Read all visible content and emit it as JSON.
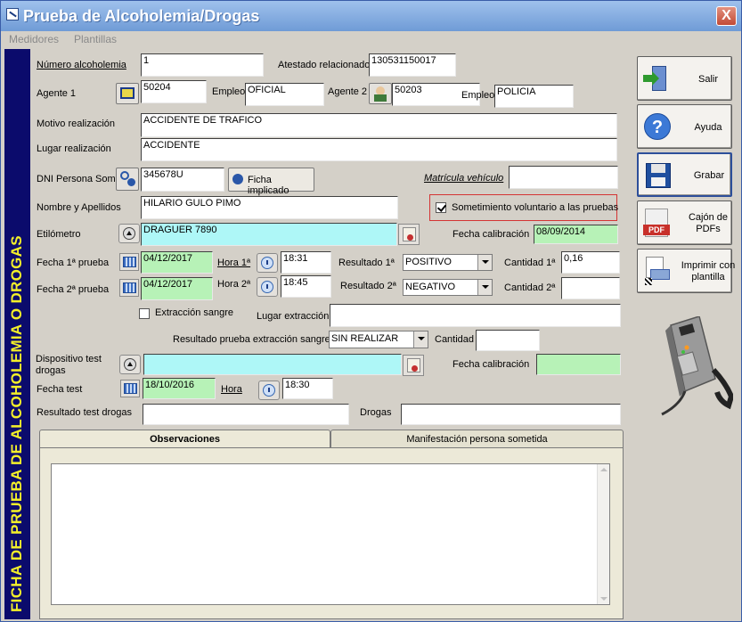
{
  "window": {
    "title": "Prueba de Alcoholemia/Drogas",
    "close_glyph": "X"
  },
  "menu": {
    "items": [
      "Medidores",
      "Plantillas"
    ]
  },
  "sidebar": {
    "text": "FICHA DE PRUEBA DE ALCOHOLEMIA O DROGAS"
  },
  "form": {
    "numero_label": "Número alcoholemia",
    "numero_value": "1",
    "atestado_label": "Atestado relacionado",
    "atestado_value": "130531150017",
    "agente1_label": "Agente 1",
    "agente1_value": "50204",
    "empleo1_label": "Empleo",
    "empleo1_value": "OFICIAL",
    "agente2_label": "Agente 2",
    "agente2_value": "50203",
    "empleo2_label": "Empleo",
    "empleo2_value": "POLICIA",
    "motivo_label": "Motivo realización",
    "motivo_value": "ACCIDENTE DE TRAFICO",
    "lugar_label": "Lugar realización",
    "lugar_value": "ACCIDENTE",
    "dni_label": "DNI Persona Som.",
    "dni_value": "345678U",
    "ficha_button": "Ficha implicado",
    "matricula_label": "Matrícula vehículo",
    "matricula_value": "",
    "nombre_label": "Nombre y Apellidos",
    "nombre_value": "HILARIO GULO PIMO",
    "sometimiento_label": "Sometimiento voluntario a las pruebas",
    "etilometro_label": "Etilómetro",
    "etilometro_value": "DRAGUER 7890",
    "fecha_cal_label": "Fecha calibración",
    "fecha_cal_value": "08/09/2014",
    "fecha1_label": "Fecha 1ª prueba",
    "fecha1_value": "04/12/2017",
    "hora1_label": "Hora 1ª",
    "hora1_value": "18:31",
    "resultado1_label": "Resultado 1ª",
    "resultado1_value": "POSITIVO",
    "cantidad1_label": "Cantidad 1ª",
    "cantidad1_value": "0,16",
    "fecha2_label": "Fecha 2ª prueba",
    "fecha2_value": "04/12/2017",
    "hora2_label": "Hora 2ª",
    "hora2_value": "18:45",
    "resultado2_label": "Resultado 2ª",
    "resultado2_value": "NEGATIVO",
    "cantidad2_label": "Cantidad 2ª",
    "cantidad2_value": "",
    "extraccion_label": "Extracción sangre",
    "lugar_extraccion_label": "Lugar extracción",
    "lugar_extraccion_value": "",
    "resultado_extraccion_label": "Resultado prueba extracción sangre",
    "resultado_extraccion_value": "SIN REALIZAR",
    "cantidad_label": "Cantidad",
    "cantidad_value": "",
    "dispositivo_label": "Dispositivo test drogas",
    "dispositivo_value": "",
    "fecha_cal2_label": "Fecha calibración",
    "fecha_cal2_value": "",
    "fecha_test_label": "Fecha test",
    "fecha_test_value": "18/10/2016",
    "hora_label": "Hora",
    "hora_value": "18:30",
    "resultado_test_label": "Resultado test drogas",
    "resultado_test_value": "",
    "drogas_label": "Drogas",
    "drogas_value": ""
  },
  "tabs": {
    "observaciones": "Observaciones",
    "manifestacion": "Manifestación persona sometida"
  },
  "actions": {
    "salir": "Salir",
    "ayuda": "Ayuda",
    "grabar": "Grabar",
    "cajon": "Cajón de PDFs",
    "imprimir": "Imprimir con plantilla"
  },
  "colors": {
    "sidebar_bg": "#0b0b6c",
    "sidebar_text": "#f3ef2a",
    "green_field": "#b7f2b7",
    "cyan_field": "#aef7f7"
  }
}
